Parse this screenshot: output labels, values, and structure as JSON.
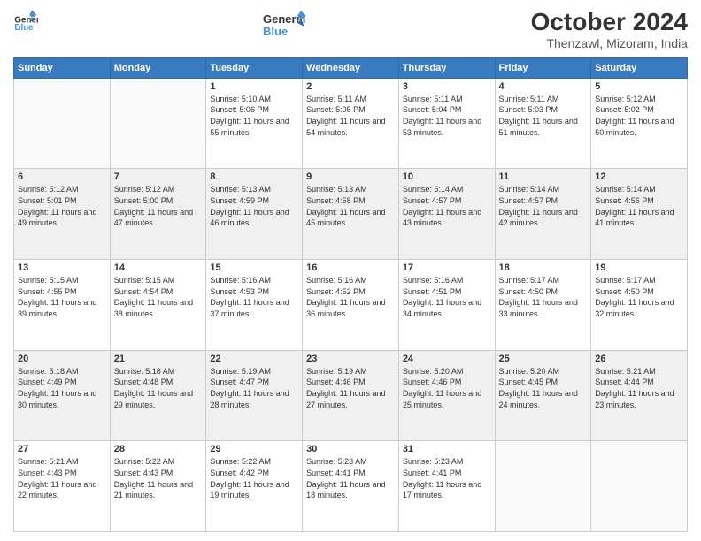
{
  "header": {
    "logo_line1": "General",
    "logo_line2": "Blue",
    "month_title": "October 2024",
    "location": "Thenzawl, Mizoram, India"
  },
  "days_of_week": [
    "Sunday",
    "Monday",
    "Tuesday",
    "Wednesday",
    "Thursday",
    "Friday",
    "Saturday"
  ],
  "weeks": [
    [
      {
        "day": "",
        "info": ""
      },
      {
        "day": "",
        "info": ""
      },
      {
        "day": "1",
        "info": "Sunrise: 5:10 AM\nSunset: 5:06 PM\nDaylight: 11 hours and 55 minutes."
      },
      {
        "day": "2",
        "info": "Sunrise: 5:11 AM\nSunset: 5:05 PM\nDaylight: 11 hours and 54 minutes."
      },
      {
        "day": "3",
        "info": "Sunrise: 5:11 AM\nSunset: 5:04 PM\nDaylight: 11 hours and 53 minutes."
      },
      {
        "day": "4",
        "info": "Sunrise: 5:11 AM\nSunset: 5:03 PM\nDaylight: 11 hours and 51 minutes."
      },
      {
        "day": "5",
        "info": "Sunrise: 5:12 AM\nSunset: 5:02 PM\nDaylight: 11 hours and 50 minutes."
      }
    ],
    [
      {
        "day": "6",
        "info": "Sunrise: 5:12 AM\nSunset: 5:01 PM\nDaylight: 11 hours and 49 minutes."
      },
      {
        "day": "7",
        "info": "Sunrise: 5:12 AM\nSunset: 5:00 PM\nDaylight: 11 hours and 47 minutes."
      },
      {
        "day": "8",
        "info": "Sunrise: 5:13 AM\nSunset: 4:59 PM\nDaylight: 11 hours and 46 minutes."
      },
      {
        "day": "9",
        "info": "Sunrise: 5:13 AM\nSunset: 4:58 PM\nDaylight: 11 hours and 45 minutes."
      },
      {
        "day": "10",
        "info": "Sunrise: 5:14 AM\nSunset: 4:57 PM\nDaylight: 11 hours and 43 minutes."
      },
      {
        "day": "11",
        "info": "Sunrise: 5:14 AM\nSunset: 4:57 PM\nDaylight: 11 hours and 42 minutes."
      },
      {
        "day": "12",
        "info": "Sunrise: 5:14 AM\nSunset: 4:56 PM\nDaylight: 11 hours and 41 minutes."
      }
    ],
    [
      {
        "day": "13",
        "info": "Sunrise: 5:15 AM\nSunset: 4:55 PM\nDaylight: 11 hours and 39 minutes."
      },
      {
        "day": "14",
        "info": "Sunrise: 5:15 AM\nSunset: 4:54 PM\nDaylight: 11 hours and 38 minutes."
      },
      {
        "day": "15",
        "info": "Sunrise: 5:16 AM\nSunset: 4:53 PM\nDaylight: 11 hours and 37 minutes."
      },
      {
        "day": "16",
        "info": "Sunrise: 5:16 AM\nSunset: 4:52 PM\nDaylight: 11 hours and 36 minutes."
      },
      {
        "day": "17",
        "info": "Sunrise: 5:16 AM\nSunset: 4:51 PM\nDaylight: 11 hours and 34 minutes."
      },
      {
        "day": "18",
        "info": "Sunrise: 5:17 AM\nSunset: 4:50 PM\nDaylight: 11 hours and 33 minutes."
      },
      {
        "day": "19",
        "info": "Sunrise: 5:17 AM\nSunset: 4:50 PM\nDaylight: 11 hours and 32 minutes."
      }
    ],
    [
      {
        "day": "20",
        "info": "Sunrise: 5:18 AM\nSunset: 4:49 PM\nDaylight: 11 hours and 30 minutes."
      },
      {
        "day": "21",
        "info": "Sunrise: 5:18 AM\nSunset: 4:48 PM\nDaylight: 11 hours and 29 minutes."
      },
      {
        "day": "22",
        "info": "Sunrise: 5:19 AM\nSunset: 4:47 PM\nDaylight: 11 hours and 28 minutes."
      },
      {
        "day": "23",
        "info": "Sunrise: 5:19 AM\nSunset: 4:46 PM\nDaylight: 11 hours and 27 minutes."
      },
      {
        "day": "24",
        "info": "Sunrise: 5:20 AM\nSunset: 4:46 PM\nDaylight: 11 hours and 25 minutes."
      },
      {
        "day": "25",
        "info": "Sunrise: 5:20 AM\nSunset: 4:45 PM\nDaylight: 11 hours and 24 minutes."
      },
      {
        "day": "26",
        "info": "Sunrise: 5:21 AM\nSunset: 4:44 PM\nDaylight: 11 hours and 23 minutes."
      }
    ],
    [
      {
        "day": "27",
        "info": "Sunrise: 5:21 AM\nSunset: 4:43 PM\nDaylight: 11 hours and 22 minutes."
      },
      {
        "day": "28",
        "info": "Sunrise: 5:22 AM\nSunset: 4:43 PM\nDaylight: 11 hours and 21 minutes."
      },
      {
        "day": "29",
        "info": "Sunrise: 5:22 AM\nSunset: 4:42 PM\nDaylight: 11 hours and 19 minutes."
      },
      {
        "day": "30",
        "info": "Sunrise: 5:23 AM\nSunset: 4:41 PM\nDaylight: 11 hours and 18 minutes."
      },
      {
        "day": "31",
        "info": "Sunrise: 5:23 AM\nSunset: 4:41 PM\nDaylight: 11 hours and 17 minutes."
      },
      {
        "day": "",
        "info": ""
      },
      {
        "day": "",
        "info": ""
      }
    ]
  ]
}
